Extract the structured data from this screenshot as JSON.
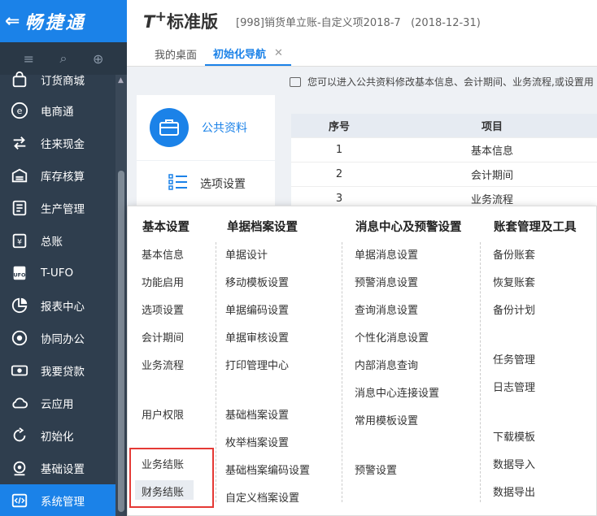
{
  "app": {
    "logo_arrow": "⇐",
    "logo_name": "畅捷通"
  },
  "sidebar": {
    "tools": [
      "≡",
      "⌕",
      "⊕"
    ],
    "items": [
      {
        "label": "订货商城",
        "icon": "bag-icon"
      },
      {
        "label": "电商通",
        "icon": "ecommerce-icon"
      },
      {
        "label": "往来现金",
        "icon": "exchange-icon"
      },
      {
        "label": "库存核算",
        "icon": "warehouse-icon"
      },
      {
        "label": "生产管理",
        "icon": "production-icon"
      },
      {
        "label": "总账",
        "icon": "ledger-icon"
      },
      {
        "label": "T-UFO",
        "icon": "ufo-icon"
      },
      {
        "label": "报表中心",
        "icon": "pie-chart-icon"
      },
      {
        "label": "协同办公",
        "icon": "collaboration-icon"
      },
      {
        "label": "我要贷款",
        "icon": "money-icon"
      },
      {
        "label": "云应用",
        "icon": "cloud-icon"
      },
      {
        "label": "初始化",
        "icon": "refresh-icon"
      },
      {
        "label": "基础设置",
        "icon": "settings-icon"
      },
      {
        "label": "系统管理",
        "icon": "system-code-icon"
      }
    ],
    "active_index": 13
  },
  "header": {
    "product_t": "T",
    "product_plus": "+",
    "product_name": "标准版",
    "account": "[998]销货单立账-自定义项2018-7   (2018-12-31)"
  },
  "tabs": [
    {
      "label": "我的桌面"
    },
    {
      "label": "初始化导航",
      "close": "✕"
    }
  ],
  "content": {
    "tip": "您可以进入公共资料修改基本信息、会计期间、业务流程,或设置用",
    "card_public": "公共资料",
    "card_options": "选项设置",
    "table": {
      "headers": [
        "序号",
        "项目"
      ],
      "rows": [
        [
          "1",
          "基本信息"
        ],
        [
          "2",
          "会计期间"
        ],
        [
          "3",
          "业务流程"
        ]
      ]
    }
  },
  "mega_menu": {
    "columns": [
      {
        "title": "基本设置",
        "items": [
          "基本信息",
          "功能启用",
          "选项设置",
          "会计期间",
          "业务流程",
          "用户权限",
          "业务结账",
          "财务结账"
        ]
      },
      {
        "title": "单据档案设置",
        "items": [
          "单据设计",
          "移动模板设置",
          "单据编码设置",
          "单据审核设置",
          "打印管理中心",
          "基础档案设置",
          "枚举档案设置",
          "基础档案编码设置",
          "自定义档案设置"
        ]
      },
      {
        "title": "消息中心及预警设置",
        "items": [
          "单据消息设置",
          "预警消息设置",
          "查询消息设置",
          "个性化消息设置",
          "内部消息查询",
          "消息中心连接设置",
          "常用模板设置",
          "预警设置"
        ]
      },
      {
        "title": "账套管理及工具",
        "items": [
          "备份账套",
          "恢复账套",
          "备份计划",
          "任务管理",
          "日志管理",
          "下载模板",
          "数据导入",
          "数据导出"
        ]
      }
    ]
  },
  "colors": {
    "accent": "#1b82e8",
    "sidebar_bg": "#2f3e4e",
    "highlight": "#e53935"
  }
}
